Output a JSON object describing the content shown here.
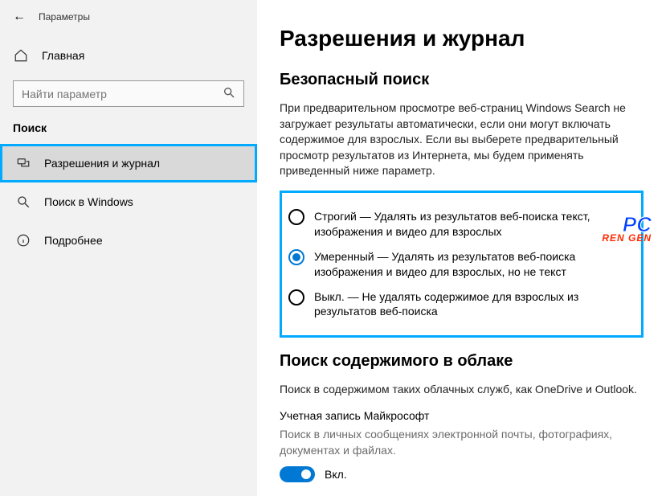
{
  "window_title": "Параметры",
  "home_label": "Главная",
  "search_placeholder": "Найти параметр",
  "section_label": "Поиск",
  "nav": {
    "permissions": "Разрешения и журнал",
    "windows_search": "Поиск в Windows",
    "more": "Подробнее"
  },
  "page": {
    "heading": "Разрешения и журнал",
    "safesearch_heading": "Безопасный поиск",
    "safesearch_body": "При предварительном просмотре веб-страниц Windows Search не загружает результаты автоматически, если они могут включать содержимое для взрослых. Если вы выберете предварительный просмотр результатов из Интернета, мы будем применять приведенный ниже параметр.",
    "options": {
      "strict": "Строгий — Удалять из результатов веб-поиска текст, изображения и видео для взрослых",
      "moderate": "Умеренный — Удалять из результатов веб-поиска изображения и видео для взрослых, но не текст",
      "off": "Выкл. — Не удалять содержимое для взрослых из результатов веб-поиска"
    },
    "cloud_heading": "Поиск содержимого в облаке",
    "cloud_body": "Поиск в содержимом таких облачных служб, как OneDrive и Outlook.",
    "ms_account_label": "Учетная запись Майкрософт",
    "ms_account_desc": "Поиск в личных сообщениях электронной почты, фотографиях, документах и файлах.",
    "toggle_label": "Вкл."
  },
  "watermark": {
    "top": "PC",
    "bot": "REN GEN"
  }
}
